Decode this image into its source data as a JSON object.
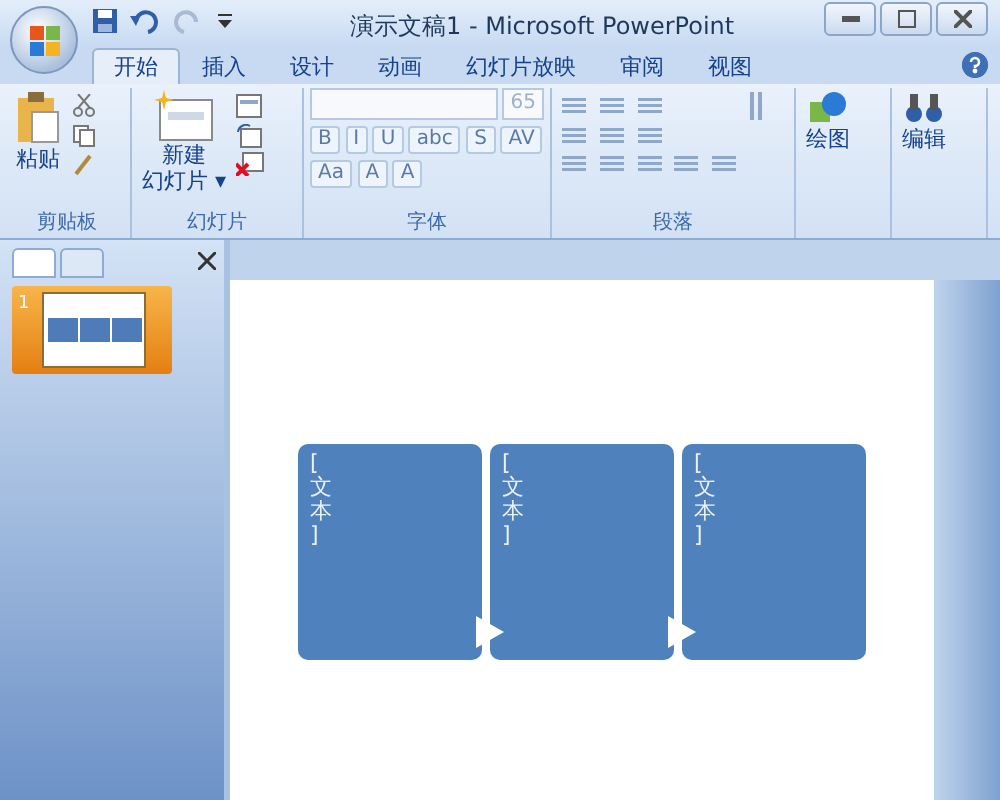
{
  "window": {
    "title": "演示文稿1 - Microsoft PowerPoint"
  },
  "tabs": [
    {
      "label": "开始",
      "selected": true
    },
    {
      "label": "插入",
      "selected": false
    },
    {
      "label": "设计",
      "selected": false
    },
    {
      "label": "动画",
      "selected": false
    },
    {
      "label": "幻灯片放映",
      "selected": false
    },
    {
      "label": "审阅",
      "selected": false
    },
    {
      "label": "视图",
      "selected": false
    }
  ],
  "ribbon": {
    "clipboard": {
      "paste": "粘贴",
      "label": "剪贴板"
    },
    "slides": {
      "new_slide": [
        "新建",
        "幻灯片 ▾"
      ],
      "label": "幻灯片"
    },
    "font": {
      "size": "65",
      "row1": [
        "B",
        "I",
        "U",
        "abc",
        "S",
        "AV"
      ],
      "row2": [
        "Aa",
        "A",
        "A"
      ],
      "label": "字体"
    },
    "paragraph": {
      "label": "段落"
    },
    "drawing": {
      "label": "绘图"
    },
    "editing": {
      "label": "编辑"
    }
  },
  "slide_panel": {
    "tabs": [
      {
        "selected": true
      },
      {
        "selected": false
      }
    ],
    "thumbnails": [
      {
        "number": "1",
        "selected": true
      }
    ]
  },
  "slide": {
    "shapes": [
      {
        "text": "[文本]",
        "arrow": true
      },
      {
        "text": "[文本]",
        "arrow": true
      },
      {
        "text": "[文本]",
        "arrow": false
      }
    ]
  }
}
